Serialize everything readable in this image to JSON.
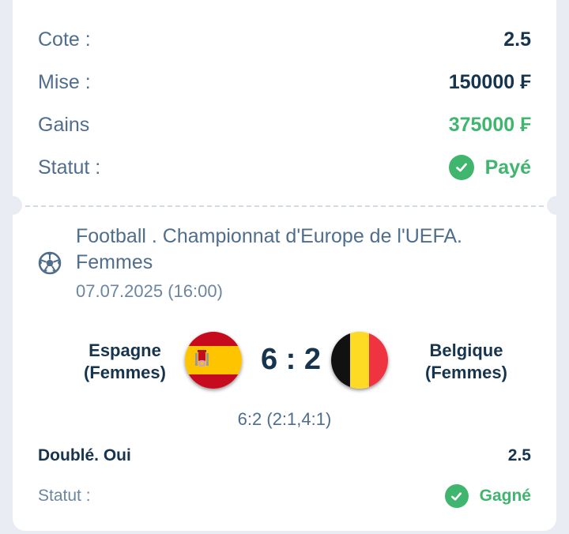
{
  "summary": {
    "cote_label": "Cote :",
    "cote_value": "2.5",
    "mise_label": "Mise :",
    "mise_value": "150000 ₣",
    "gains_label": "Gains",
    "gains_value": "375000 ₣",
    "statut_label": "Statut :",
    "statut_value": "Payé"
  },
  "event": {
    "icon": "soccer-ball-icon",
    "title": "Football . Championnat d'Europe de l'UEFA. Femmes",
    "datetime": "07.07.2025 (16:00)",
    "home_team": "Espagne (Femmes)",
    "away_team": "Belgique (Femmes)",
    "home_flag": "spain-flag-icon",
    "away_flag": "belgium-flag-icon",
    "score": "6 : 2",
    "score_detail": "6:2 (2:1,4:1)"
  },
  "bet": {
    "name": "Doublé. Oui",
    "odd": "2.5",
    "status_label": "Statut :",
    "status_value": "Gagné"
  },
  "colors": {
    "accent_green": "#3fb56e",
    "navy": "#17344f",
    "muted_blue": "#4f6e8c",
    "background": "#e9edf3"
  }
}
